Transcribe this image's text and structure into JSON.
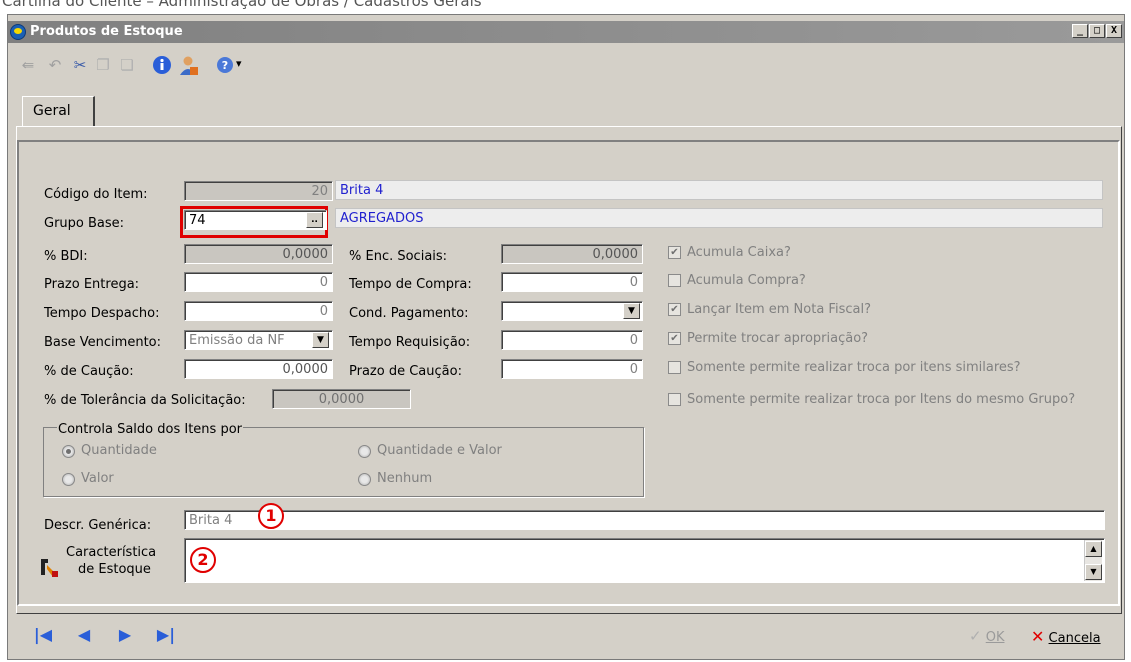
{
  "doc_header": "Cartilha do Cliente – Administração de Obras / Cadastros Gerais",
  "window": {
    "title": "Produtos de Estoque",
    "buttons": [
      "_",
      "□",
      "X"
    ]
  },
  "toolbar": {
    "icons": [
      "save-icon",
      "undo-icon",
      "cut-icon",
      "copy-icon",
      "paste-icon",
      "info-icon",
      "user-icon",
      "help-icon"
    ],
    "help_dropdown": "▾"
  },
  "tabs": [
    {
      "label": "Geral"
    }
  ],
  "form": {
    "codigo": {
      "label": "Código do Item:",
      "value": "20",
      "desc": "Brita 4"
    },
    "grupo": {
      "label": "Grupo Base:",
      "value": "74",
      "button": "..",
      "desc": "AGREGADOS"
    },
    "bdi": {
      "label": "% BDI:",
      "value": "0,0000"
    },
    "enc_sociais": {
      "label": "% Enc. Sociais:",
      "value": "0,0000"
    },
    "prazo_entrega": {
      "label": "Prazo Entrega:",
      "value": "0"
    },
    "tempo_compra": {
      "label": "Tempo de Compra:",
      "value": "0"
    },
    "tempo_despacho": {
      "label": "Tempo Despacho:",
      "value": "0"
    },
    "cond_pagamento": {
      "label": "Cond. Pagamento:",
      "value": ""
    },
    "base_vencimento": {
      "label": "Base Vencimento:",
      "value": "Emissão da NF"
    },
    "tempo_requisicao": {
      "label": "Tempo Requisição:",
      "value": "0"
    },
    "caucao": {
      "label": "% de Caução:",
      "value": "0,0000"
    },
    "prazo_caucao": {
      "label": "Prazo de Caução:",
      "value": "0"
    },
    "tolerancia": {
      "label": "% de Tolerância da Solicitação:",
      "value": "0,0000"
    },
    "checkboxes": [
      {
        "label": "Acumula Caixa?",
        "checked": true
      },
      {
        "label": "Acumula Compra?",
        "checked": false
      },
      {
        "label": "Lançar Item em Nota Fiscal?",
        "checked": true
      },
      {
        "label": "Permite trocar apropriação?",
        "checked": true
      },
      {
        "label": "Somente permite realizar troca por itens similares?",
        "checked": false
      },
      {
        "label": "Somente permite realizar troca por Itens do mesmo Grupo?",
        "checked": false
      }
    ],
    "saldo_group": {
      "title": "Controla Saldo dos Itens por",
      "options": [
        {
          "label": "Quantidade",
          "selected": true
        },
        {
          "label": "Quantidade e Valor",
          "selected": false
        },
        {
          "label": "Valor",
          "selected": false
        },
        {
          "label": "Nenhum",
          "selected": false
        }
      ]
    },
    "descr_generica": {
      "label": "Descr. Genérica:",
      "value": "Brita 4"
    },
    "caracteristica": {
      "label_line1": "Característica",
      "label_line2": "de Estoque",
      "value": ""
    }
  },
  "callouts": [
    "1",
    "2"
  ],
  "nav": {
    "first": "first-record-icon",
    "prev": "previous-record-icon",
    "next": "next-record-icon",
    "last": "last-record-icon"
  },
  "actions": {
    "ok": "OK",
    "cancel": "Cancela"
  }
}
